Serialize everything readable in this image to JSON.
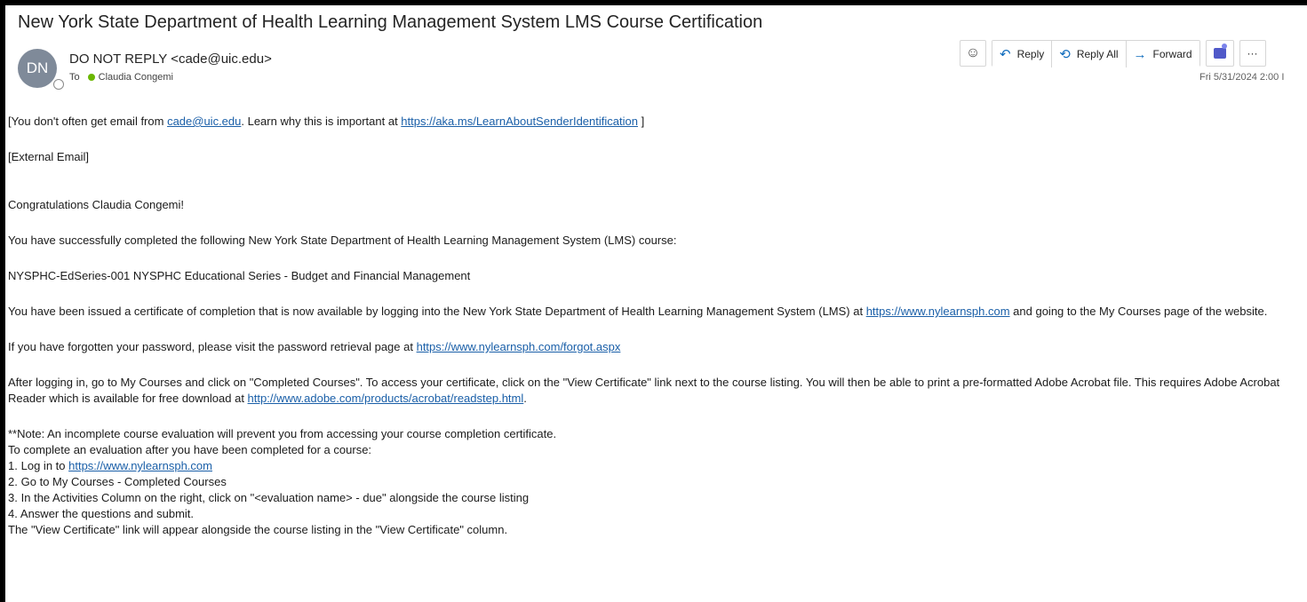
{
  "email": {
    "subject": "New York State Department of Health Learning Management System LMS Course Certification",
    "avatar_initials": "DN",
    "sender": "DO NOT REPLY <cade@uic.edu>",
    "to_label": "To",
    "recipient": "Claudia Congemi",
    "date": "Fri 5/31/2024 2:00 I"
  },
  "toolbar": {
    "emoji_icon": "smiley-icon",
    "reply_label": "Reply",
    "reply_all_label": "Reply All",
    "forward_label": "Forward",
    "more_label": "···"
  },
  "body": {
    "warning_pre": "[You don't often get email from ",
    "warning_link_email": "cade@uic.edu",
    "warning_mid": ". Learn why this is important at ",
    "warning_link_url": "https://aka.ms/LearnAboutSenderIdentification",
    "warning_post": " ]",
    "external": "[External Email]",
    "congrats": "Congratulations Claudia Congemi!",
    "completed": "You have successfully completed the following New York State Department of Health Learning Management System (LMS) course:",
    "course": " NYSPHC-EdSeries-001 NYSPHC Educational Series - Budget and Financial Management",
    "issued_pre": "You have been issued a certificate of completion that is now available by logging into the New York State Department of Health Learning Management System (LMS) at ",
    "issued_link": "https://www.nylearnsph.com",
    "issued_post": " and going to the My Courses page of the website.",
    "forgot_pre": "If you have forgotten your password, please visit the password retrieval page at ",
    "forgot_link": "https://www.nylearnsph.com/forgot.aspx",
    "after_pre": "After logging in, go to My Courses and click on \"Completed Courses\". To access your certificate, click on the \"View Certificate\" link next to the course listing. You will then be able to print a pre-formatted Adobe Acrobat file. This requires Adobe Acrobat Reader which is available for free download at ",
    "after_link": "http://www.adobe.com/products/acrobat/readstep.html",
    "after_post": ".",
    "note": "**Note: An incomplete course evaluation will prevent you from accessing your course completion certificate.",
    "to_complete": "To complete an evaluation after you have been completed for a course:",
    "steps": [
      {
        "num": "1.",
        "pre": "Log in to ",
        "link": "https://www.nylearnsph.com"
      },
      {
        "num": "2.",
        "text": "Go to My Courses - Completed Courses"
      },
      {
        "num": "3.",
        "text": "In the Activities Column on the right, click on \"<evaluation name> - due\" alongside the course listing"
      },
      {
        "num": "4.",
        "text": "Answer the questions and submit."
      }
    ],
    "view_cert": "The \"View Certificate\" link will appear alongside the course listing in the \"View Certificate\" column."
  }
}
